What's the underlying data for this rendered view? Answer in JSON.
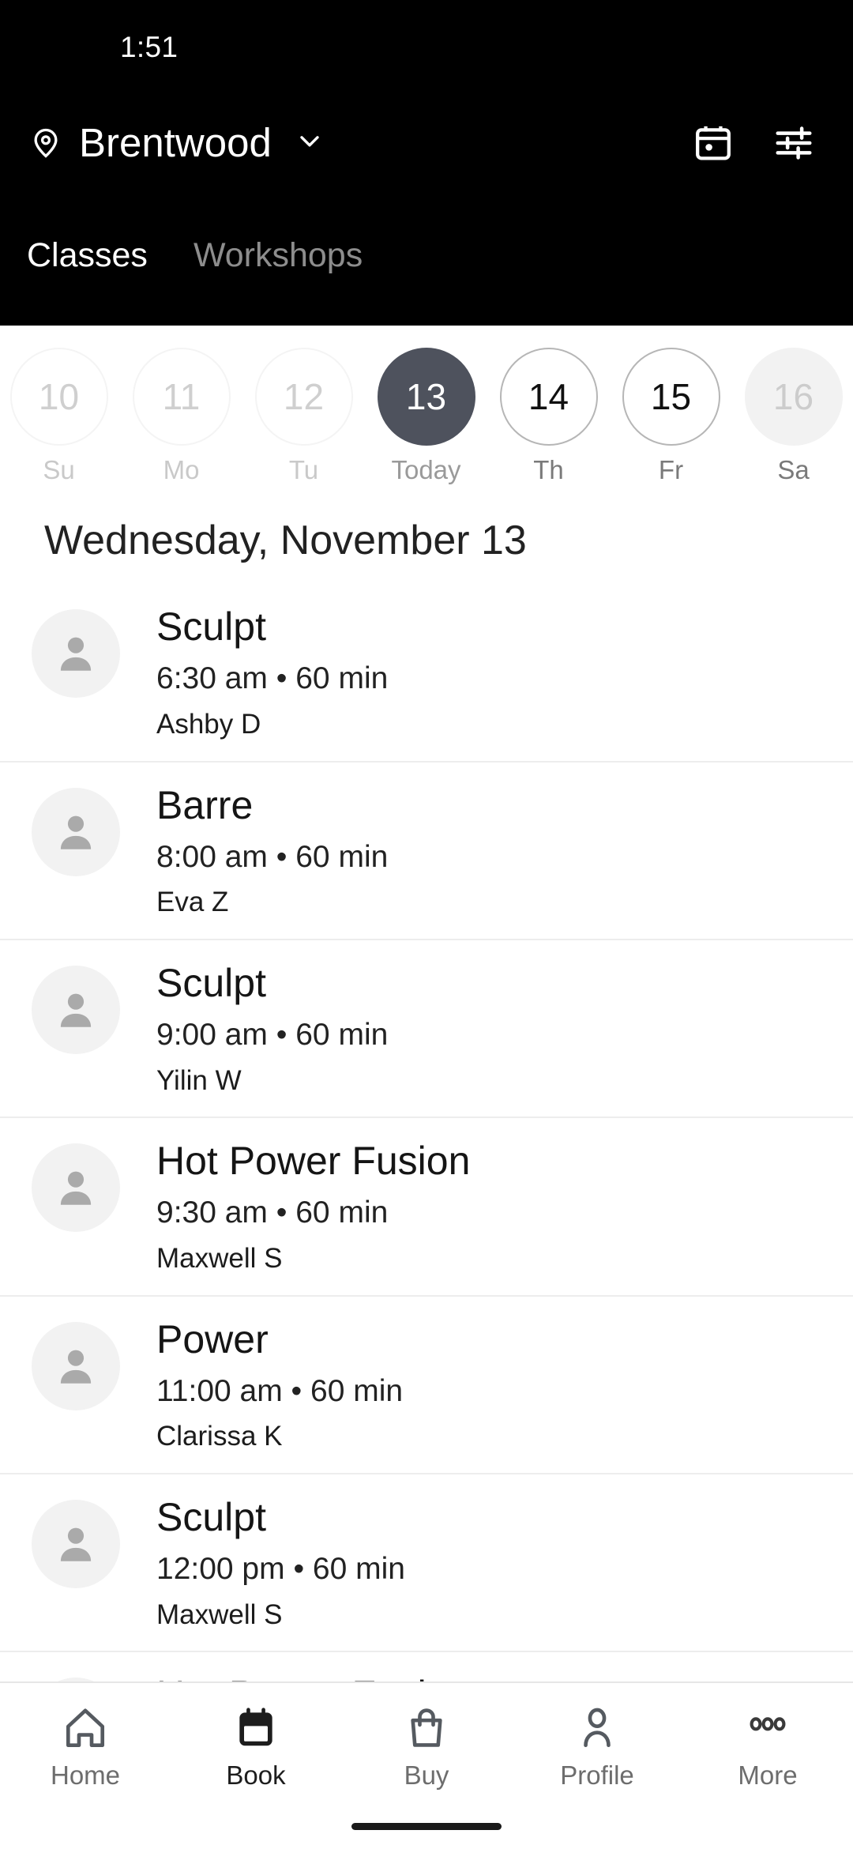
{
  "status_bar": {
    "time": "1:51"
  },
  "header": {
    "location": "Brentwood",
    "location_pin_icon": "location-pin-icon",
    "location_chevron_icon": "chevron-down-icon",
    "actions": [
      {
        "name": "calendar-icon",
        "label": "Calendar"
      },
      {
        "name": "filter-sliders-icon",
        "label": "Filters"
      }
    ],
    "tabs": [
      {
        "label": "Classes",
        "active": true
      },
      {
        "label": "Workshops",
        "active": false
      }
    ]
  },
  "date_strip": [
    {
      "day": "10",
      "dow": "Su",
      "state": "past"
    },
    {
      "day": "11",
      "dow": "Mo",
      "state": "past"
    },
    {
      "day": "12",
      "dow": "Tu",
      "state": "past"
    },
    {
      "day": "13",
      "dow": "Today",
      "state": "selected"
    },
    {
      "day": "14",
      "dow": "Th",
      "state": "future"
    },
    {
      "day": "15",
      "dow": "Fr",
      "state": "future"
    },
    {
      "day": "16",
      "dow": "Sa",
      "state": "faded"
    }
  ],
  "day_heading": "Wednesday, November 13",
  "classes": [
    {
      "title": "Sculpt",
      "meta": "6:30 am • 60 min",
      "teacher": "Ashby D",
      "avatar_icon": "person-avatar-icon"
    },
    {
      "title": "Barre",
      "meta": "8:00 am • 60 min",
      "teacher": "Eva Z",
      "avatar_icon": "person-avatar-icon"
    },
    {
      "title": "Sculpt",
      "meta": "9:00 am • 60 min",
      "teacher": "Yilin W",
      "avatar_icon": "person-avatar-icon"
    },
    {
      "title": "Hot Power Fusion",
      "meta": "9:30 am • 60 min",
      "teacher": "Maxwell S",
      "avatar_icon": "person-avatar-icon"
    },
    {
      "title": "Power",
      "meta": "11:00 am • 60 min",
      "teacher": "Clarissa K",
      "avatar_icon": "person-avatar-icon"
    },
    {
      "title": "Sculpt",
      "meta": "12:00 pm • 60 min",
      "teacher": "Maxwell S",
      "avatar_icon": "person-avatar-icon"
    },
    {
      "title": "Hot Power Fusion",
      "meta": "",
      "teacher": "",
      "avatar_icon": "person-avatar-icon"
    }
  ],
  "bottom_nav": [
    {
      "label": "Home",
      "icon": "home-icon",
      "active": false
    },
    {
      "label": "Book",
      "icon": "calendar-filled-icon",
      "active": true
    },
    {
      "label": "Buy",
      "icon": "shopping-bag-icon",
      "active": false
    },
    {
      "label": "Profile",
      "icon": "person-icon",
      "active": false
    },
    {
      "label": "More",
      "icon": "more-dots-icon",
      "active": false
    }
  ],
  "colors": {
    "header_bg": "#000000",
    "selected_date_bg": "#4e525d",
    "tab_active": "#ffffff",
    "tab_inactive": "#8d8d8d",
    "divider": "#ededed",
    "avatar_bg": "#f2f2f2"
  }
}
